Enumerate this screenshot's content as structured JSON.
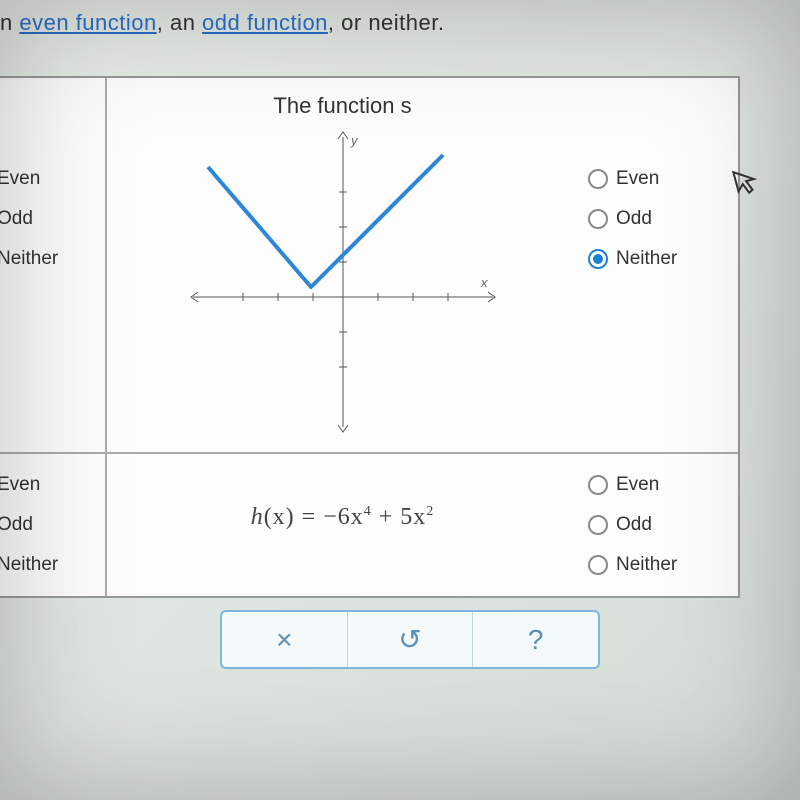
{
  "top_text": {
    "prefix": "n ",
    "link1": "even function",
    "mid": ", an ",
    "link2": "odd function",
    "suffix": ", or neither."
  },
  "cell1": {
    "title": "The function s",
    "options": [
      "Even",
      "Odd",
      "Neither"
    ],
    "left_selected_index": -1,
    "right_selected_index": 2
  },
  "cell2": {
    "formula_h": "h",
    "formula_x": "(x) = −6x",
    "formula_exp1": "4",
    "formula_plus": " + 5x",
    "formula_exp2": "2",
    "options": [
      "Even",
      "Odd",
      "Neither"
    ],
    "left_selected_index": 2,
    "right_selected_index": -1
  },
  "toolbar": {
    "close": "×",
    "undo": "↺",
    "help": "?"
  },
  "cursor_glyph": "↖",
  "chart_data": {
    "type": "line",
    "title": "The function s",
    "xlabel": "x",
    "ylabel": "y",
    "xlim": [
      -4,
      4
    ],
    "ylim": [
      -4,
      4
    ],
    "series": [
      {
        "name": "s(x)",
        "x": [
          -4,
          -1,
          2.7
        ],
        "y": [
          3.6,
          0.3,
          4
        ]
      }
    ],
    "annotations": [
      "V-shaped graph with vertex near (-1, 0.3)"
    ]
  }
}
